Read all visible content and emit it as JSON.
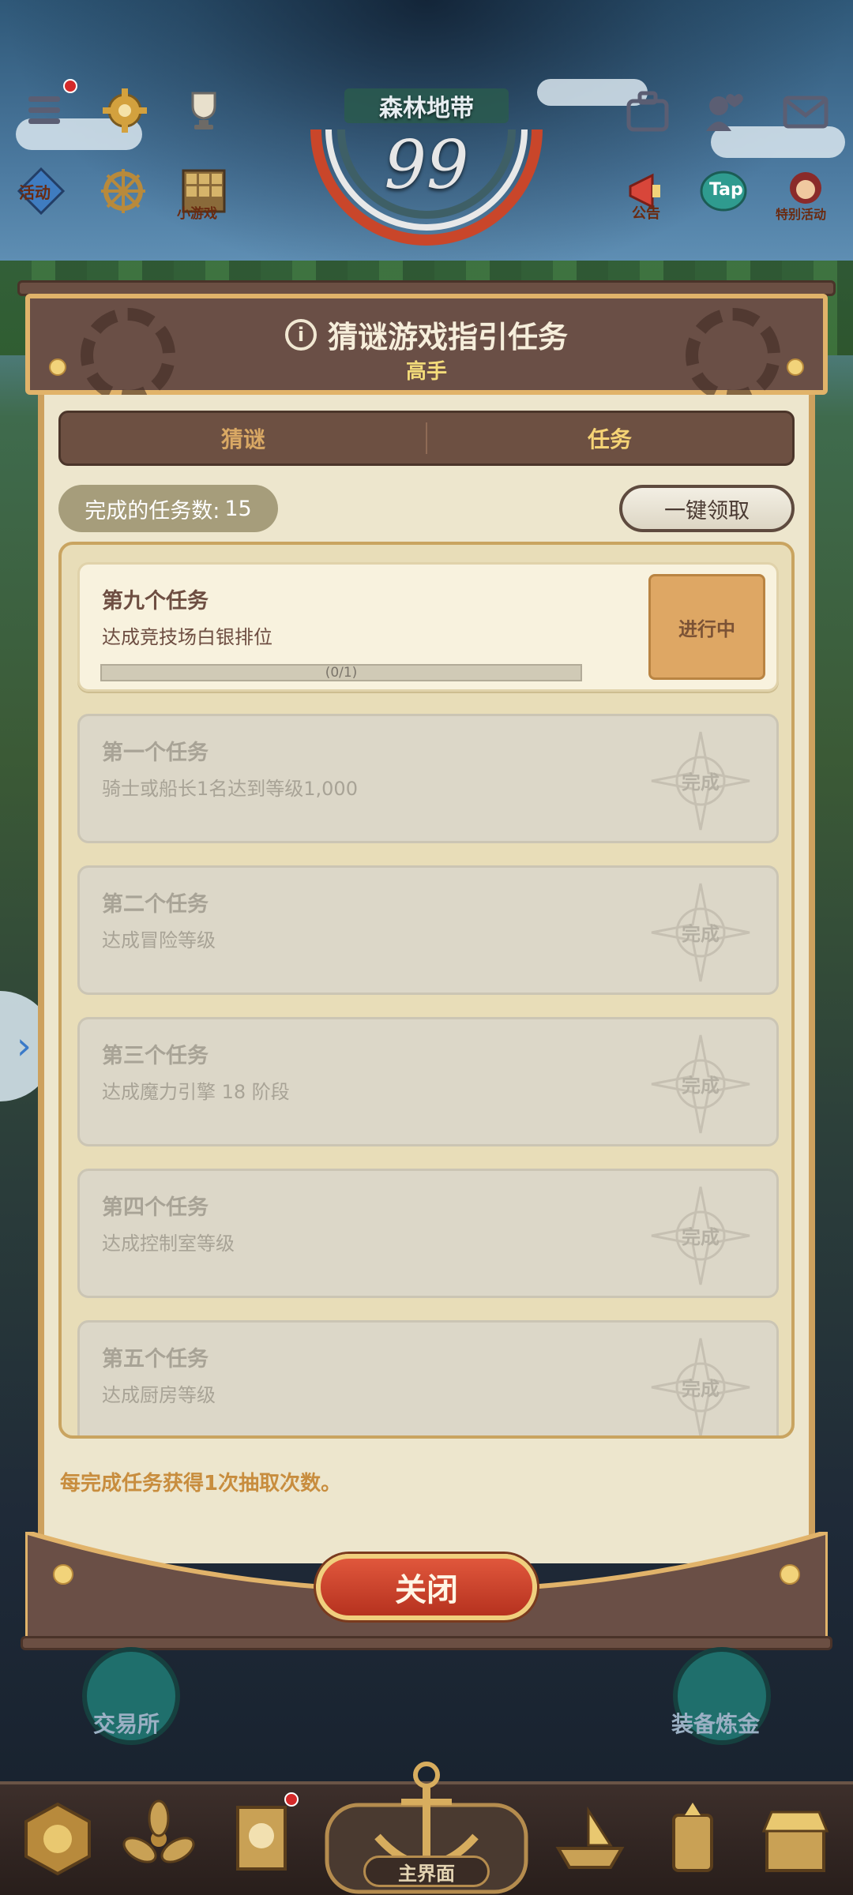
{
  "hud": {
    "zone_name": "森林地带",
    "level": "99",
    "activity_label": "活动",
    "minigame_label": "小游戏",
    "notice_label": "公告",
    "tap_label": "Tap",
    "special_label": "特别活动"
  },
  "dialog": {
    "title": "猜谜游戏指引任务",
    "subtitle": "高手",
    "tabs": [
      {
        "label": "猜谜",
        "active": false
      },
      {
        "label": "任务",
        "active": true
      }
    ],
    "completed_label": "完成的任务数:",
    "completed_count": "15",
    "claim_all_label": "一键领取",
    "tasks": [
      {
        "name": "第九个任务",
        "desc": "达成竞技场白银排位",
        "state": "active",
        "progress_text": "(0/1)",
        "progress": 0,
        "status": "进行中"
      },
      {
        "name": "第一个任务",
        "desc": "骑士或船长1名达到等级1,000",
        "state": "done",
        "status": "完成"
      },
      {
        "name": "第二个任务",
        "desc": "达成冒险等级",
        "state": "done",
        "status": "完成"
      },
      {
        "name": "第三个任务",
        "desc": "达成魔力引擎 18 阶段",
        "state": "done",
        "status": "完成"
      },
      {
        "name": "第四个任务",
        "desc": "达成控制室等级",
        "state": "done",
        "status": "完成"
      },
      {
        "name": "第五个任务",
        "desc": "达成厨房等级",
        "state": "done",
        "status": "完成"
      }
    ],
    "footer_note": "每完成任务获得1次抽取次数。",
    "close_label": "关闭"
  },
  "bottom": {
    "exchange_label": "交易所",
    "alchemy_label": "装备炼金",
    "home_label": "主界面"
  },
  "colors": {
    "panel_bg": "#ede6cd",
    "header_brown": "#6a4f46",
    "gold_trim": "#e1b36a",
    "active_status": "#dea764",
    "close_red": "#c53d28"
  }
}
